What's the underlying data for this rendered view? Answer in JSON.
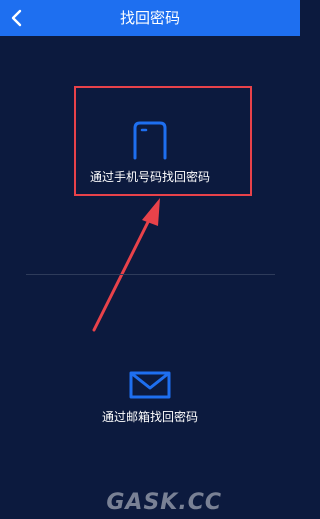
{
  "header": {
    "title": "找回密码",
    "back_icon": "chevron-left-icon"
  },
  "options": [
    {
      "label": "通过手机号码找回密码",
      "icon": "phone-icon"
    },
    {
      "label": "通过邮箱找回密码",
      "icon": "envelope-icon"
    }
  ],
  "watermark": "GASK.CC",
  "colors": {
    "header_bg": "#1e6ff0",
    "page_bg": "#0c1a3e",
    "icon_blue": "#1e6ff0",
    "annotation_red": "#e8424a"
  }
}
